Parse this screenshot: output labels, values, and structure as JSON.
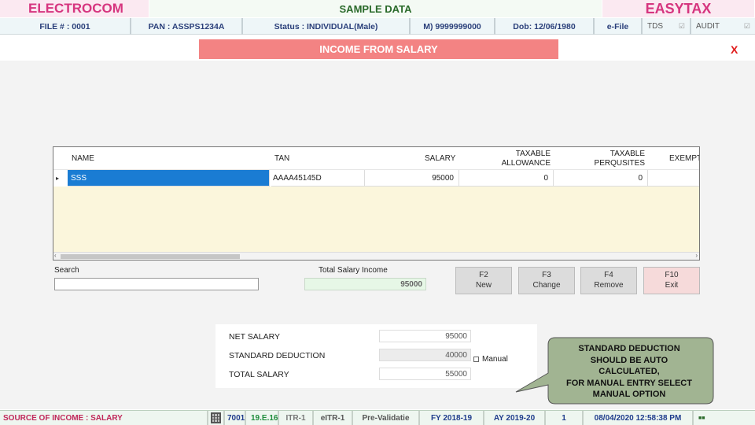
{
  "header": {
    "brand_left": "ELECTROCOM",
    "brand_center": "SAMPLE DATA",
    "brand_right": "EASYTAX"
  },
  "info": {
    "file": "FILE # : 0001",
    "pan": "PAN : ASSPS1234A",
    "status": "Status : INDIVIDUAL(Male)",
    "mobile": "M) 9999999000",
    "dob": "Dob: 12/06/1980",
    "efile": "e-File",
    "tds": "TDS",
    "audit": "AUDIT"
  },
  "form": {
    "title": "INCOME FROM SALARY",
    "close": "X"
  },
  "grid": {
    "columns": {
      "name": "NAME",
      "tan": "TAN",
      "salary": "SALARY",
      "taxable_allowance_1": "TAXABLE",
      "taxable_allowance_2": "ALLOWANCE",
      "taxable_perquisites_1": "TAXABLE",
      "taxable_perquisites_2": "PERQUSITES",
      "exempt": "EXEMPT"
    },
    "rows": [
      {
        "name": "SSS",
        "tan": "AAAA45145D",
        "salary": "95000",
        "taxable_allowance": "0",
        "taxable_perquisites": "0"
      }
    ]
  },
  "search": {
    "label": "Search",
    "value": ""
  },
  "total_salary": {
    "label": "Total Salary Income",
    "value": "95000"
  },
  "buttons": {
    "new": {
      "key": "F2",
      "label": "New"
    },
    "change": {
      "key": "F3",
      "label": "Change"
    },
    "remove": {
      "key": "F4",
      "label": "Remove"
    },
    "exit": {
      "key": "F10",
      "label": "Exit"
    }
  },
  "deduction": {
    "net_salary_label": "NET SALARY",
    "net_salary": "95000",
    "standard_deduction_label": "STANDARD DEDUCTION",
    "standard_deduction": "40000",
    "manual_label": "Manual",
    "manual_checked": false,
    "total_salary_label": "TOTAL SALARY",
    "total_salary": "55000"
  },
  "callout": {
    "line1": "STANDARD DEDUCTION",
    "line2": "SHOULD BE AUTO",
    "line3": "CALCULATED,",
    "line4": "FOR MANUAL ENTRY SELECT",
    "line5": "MANUAL OPTION"
  },
  "status_bar": {
    "source": "SOURCE OF INCOME : SALARY",
    "code": "7001",
    "version": "19.E.16",
    "itr1": "ITR-1",
    "eitr1": "eITR-1",
    "prevalidate": "Pre-Validatie",
    "fy": "FY 2018-19",
    "ay": "AY 2019-20",
    "page": "1",
    "datetime": "08/04/2020 12:58:38 PM",
    "dots": "■■"
  },
  "colors": {
    "brand_pink": "#d6357f",
    "title_salmon": "#f38383",
    "selection_blue": "#1a7cd3",
    "grid_cream": "#fbf6dc",
    "callout_green": "#a1b492",
    "close_red": "#e01c1c"
  }
}
